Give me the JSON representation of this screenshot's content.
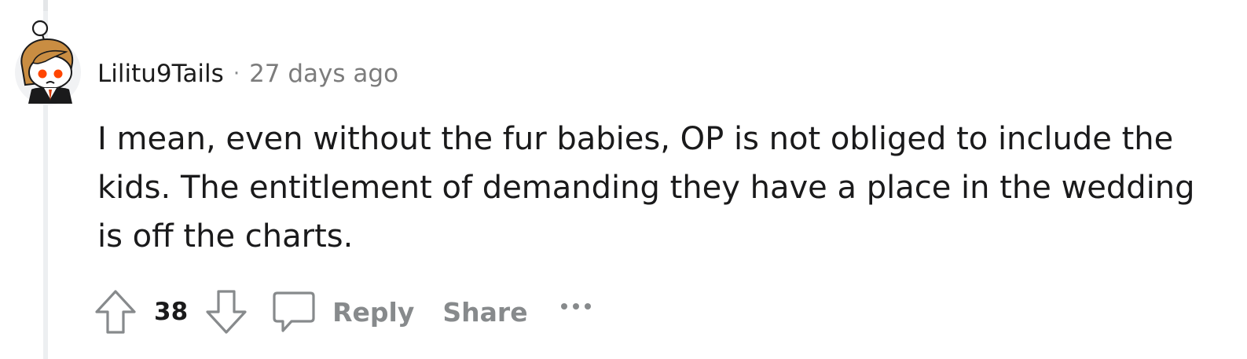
{
  "comment": {
    "author": "Lilitu9Tails",
    "separator": "·",
    "timestamp": "27 days ago",
    "body": "I mean, even without the fur babies, OP is not obliged to include the kids. The entitlement of demanding they have a place in the wedding is off the charts.",
    "score": "38"
  },
  "actions": {
    "reply_label": "Reply",
    "share_label": "Share"
  },
  "icons": {
    "avatar": "snoo-avatar",
    "upvote": "arrow-up-outline-icon",
    "downvote": "arrow-down-outline-icon",
    "reply": "speech-bubble-icon",
    "more": "ellipsis-icon"
  },
  "colors": {
    "text_primary": "#1a1a1b",
    "text_muted": "#878a8c",
    "thread_line": "#edeff1",
    "avatar_eyes": "#ff4500"
  }
}
